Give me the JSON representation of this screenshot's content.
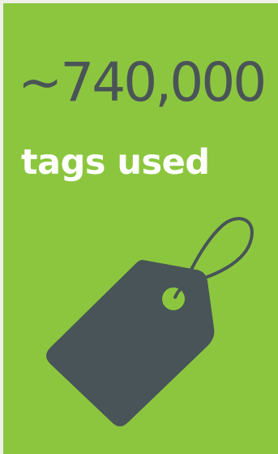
{
  "card": {
    "stat_value": "~740,000",
    "stat_label": "tags used",
    "icon": "price-tag-icon",
    "colors": {
      "background": "#8cc63f",
      "number_text": "#4a5457",
      "label_text": "#ffffff",
      "icon": "#485457"
    }
  }
}
